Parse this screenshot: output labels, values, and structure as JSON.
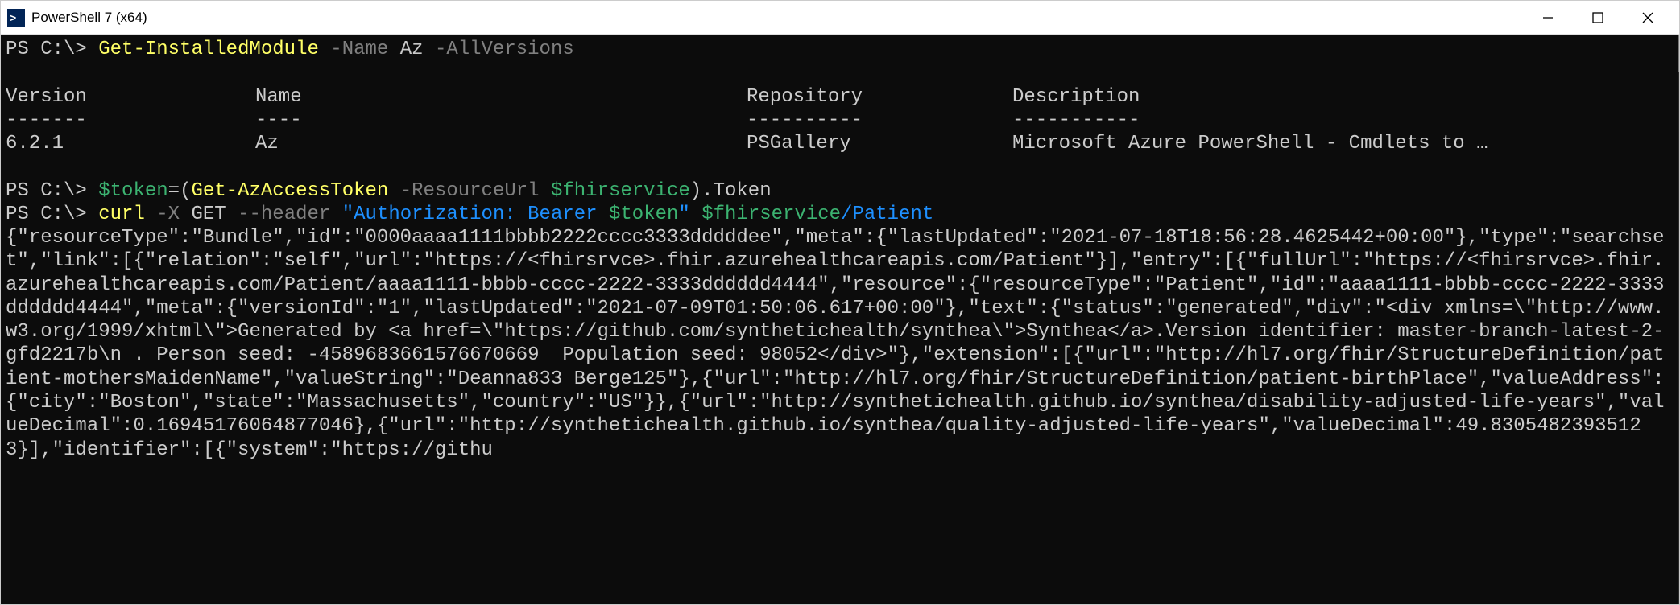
{
  "window": {
    "title": "PowerShell 7 (x64)"
  },
  "prompt": "PS C:\\>",
  "cmd1": {
    "cmdlet": "Get-InstalledModule",
    "paramName": "-Name",
    "argName": "Az",
    "paramAll": "-AllVersions"
  },
  "table": {
    "headers": {
      "version": "Version",
      "name": "Name",
      "repository": "Repository",
      "description": "Description"
    },
    "dashes": {
      "version": "-------",
      "name": "----",
      "repository": "----------",
      "description": "-----------"
    },
    "rows": [
      {
        "version": "6.2.1",
        "name": "Az",
        "repository": "PSGallery",
        "description": "Microsoft Azure PowerShell - Cmdlets to …"
      }
    ]
  },
  "cmd2": {
    "assignLhs": "$token",
    "eq": "=(",
    "cmdlet": "Get-AzAccessToken",
    "param": "-ResourceUrl",
    "var": "$fhirservice",
    "tail": ").Token"
  },
  "cmd3": {
    "curl": "curl",
    "dashX": "-X",
    "GET": "GET",
    "header": "--header",
    "authStr1": "\"Authorization: Bearer ",
    "tokenVar": "$token",
    "authStr2": "\"",
    "serviceVar": "$fhirservice",
    "pathStr": "/Patient"
  },
  "jsonOutput": "{\"resourceType\":\"Bundle\",\"id\":\"0000aaaa1111bbbb2222cccc3333dddddee\",\"meta\":{\"lastUpdated\":\"2021-07-18T18:56:28.4625442+00:00\"},\"type\":\"searchset\",\"link\":[{\"relation\":\"self\",\"url\":\"https://<fhirsrvce>.fhir.azurehealthcareapis.com/Patient\"}],\"entry\":[{\"fullUrl\":\"https://<fhirsrvce>.fhir.azurehealthcareapis.com/Patient/aaaa1111-bbbb-cccc-2222-3333dddddd4444\",\"resource\":{\"resourceType\":\"Patient\",\"id\":\"aaaa1111-bbbb-cccc-2222-3333dddddd4444\",\"meta\":{\"versionId\":\"1\",\"lastUpdated\":\"2021-07-09T01:50:06.617+00:00\"},\"text\":{\"status\":\"generated\",\"div\":\"<div xmlns=\\\"http://www.w3.org/1999/xhtml\\\">Generated by <a href=\\\"https://github.com/synthetichealth/synthea\\\">Synthea</a>.Version identifier: master-branch-latest-2-gfd2217b\\n . Person seed: -4589683661576670669  Population seed: 98052</div>\"},\"extension\":[{\"url\":\"http://hl7.org/fhir/StructureDefinition/patient-mothersMaidenName\",\"valueString\":\"Deanna833 Berge125\"},{\"url\":\"http://hl7.org/fhir/StructureDefinition/patient-birthPlace\",\"valueAddress\":{\"city\":\"Boston\",\"state\":\"Massachusetts\",\"country\":\"US\"}},{\"url\":\"http://synthetichealth.github.io/synthea/disability-adjusted-life-years\",\"valueDecimal\":0.16945176064877046},{\"url\":\"http://synthetichealth.github.io/synthea/quality-adjusted-life-years\",\"valueDecimal\":49.83054823935123}],\"identifier\":[{\"system\":\"https://githu"
}
